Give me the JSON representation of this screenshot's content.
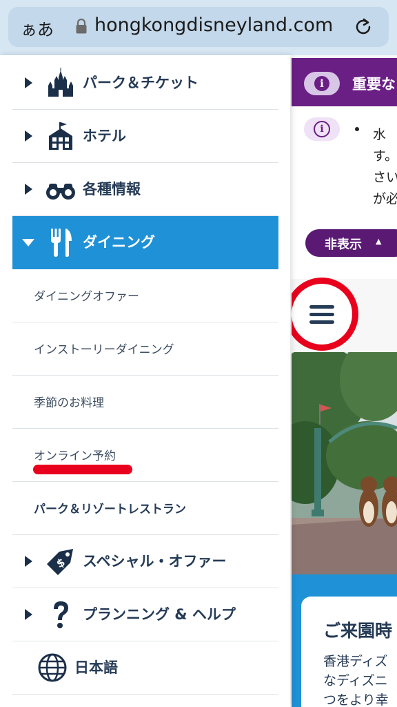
{
  "browser": {
    "text_size_label": "ぁあ",
    "url": "hongkongdisneyland.com"
  },
  "menu": {
    "items": [
      {
        "label": "パーク＆チケット",
        "icon": "castle-icon"
      },
      {
        "label": "ホテル",
        "icon": "hotel-icon"
      },
      {
        "label": "各種情報",
        "icon": "binoculars-icon"
      },
      {
        "label": "ダイニング",
        "icon": "fork-knife-icon",
        "expanded": true
      },
      {
        "label": "スペシャル・オファー",
        "icon": "price-tag-icon"
      },
      {
        "label": "プランニング & ヘルプ",
        "icon": "question-mark-icon"
      },
      {
        "label": "日本語",
        "icon": "globe-icon"
      }
    ],
    "dining_subitems": [
      {
        "label": "ダイニングオファー"
      },
      {
        "label": "インストーリーダイニング"
      },
      {
        "label": "季節のお料理"
      },
      {
        "label": "オンライン予約"
      },
      {
        "label": "パーク＆リゾートレストラン"
      }
    ]
  },
  "page": {
    "alert_title": "重要な",
    "notice_lines": [
      "水",
      "す。",
      "さい",
      "が必"
    ],
    "hide_button_label": "非表示",
    "info_title": "ご来園時",
    "info_body": [
      "香港ディズ",
      "なディズニ",
      "つをより幸"
    ]
  },
  "colors": {
    "accent": "#1f91d6",
    "navy": "#253b56",
    "alert_purple": "#6a1f84",
    "highlight_red": "#e8001c"
  }
}
